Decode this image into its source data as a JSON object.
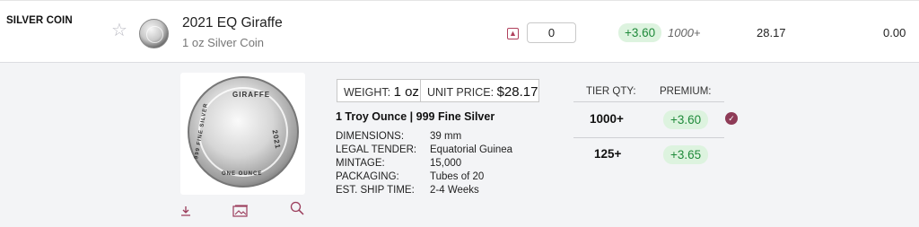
{
  "row": {
    "category": "SILVER COIN",
    "star_icon": "star-outline-icon",
    "name": "2021 EQ Giraffe",
    "subtitle": "1 oz Silver Coin",
    "collapse_icon": "chevron-up-icon",
    "qty_value": "0",
    "premium": "+3.60",
    "tier": "1000+",
    "price": "28.17",
    "total": "0.00"
  },
  "detail": {
    "coin_engraving_top": "GIRAFFE",
    "coin_engraving_year": "2021",
    "coin_engraving_bottom": "ONE OUNCE",
    "coin_engraving_left": "999 FINE SILVER",
    "weight_label": "WEIGHT:",
    "weight_value": "1 oz",
    "unit_price_label": "UNIT PRICE:",
    "unit_price_value": "$28.17",
    "heading": "1 Troy Ounce | 999 Fine Silver",
    "specs": [
      {
        "label": "DIMENSIONS:",
        "value": "39 mm"
      },
      {
        "label": "LEGAL TENDER:",
        "value": "Equatorial Guinea"
      },
      {
        "label": "MINTAGE:",
        "value": "15,000"
      },
      {
        "label": "PACKAGING:",
        "value": "Tubes of 20"
      },
      {
        "label": "EST. SHIP TIME:",
        "value": "2-4 Weeks"
      }
    ],
    "actions": {
      "download_icon": "download-icon",
      "gallery_icon": "image-gallery-icon",
      "zoom_icon": "magnifier-icon"
    }
  },
  "tiers": {
    "qty_header": "TIER QTY:",
    "premium_header": "PREMIUM:",
    "rows": [
      {
        "qty": "1000+",
        "premium": "+3.60"
      },
      {
        "qty": "125+",
        "premium": "+3.65"
      }
    ],
    "active_icon": "verified-check-icon"
  },
  "colors": {
    "accent": "#9a3b5a",
    "premium_bg": "#ddf3df",
    "premium_text": "#1f8a3a"
  }
}
